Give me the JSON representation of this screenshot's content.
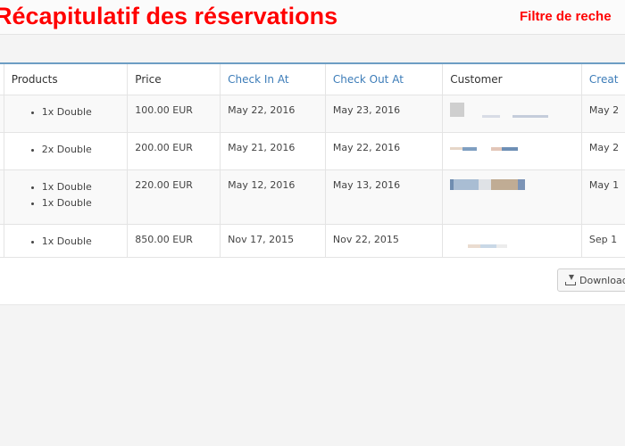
{
  "overlay": {
    "title": "Récapitulatif des réservations",
    "filter_label": "Filtre de reche"
  },
  "table": {
    "columns": [
      {
        "label": "Products",
        "sortable": false
      },
      {
        "label": "Price",
        "sortable": false
      },
      {
        "label": "Check In At",
        "sortable": true
      },
      {
        "label": "Check Out At",
        "sortable": true
      },
      {
        "label": "Customer",
        "sortable": false
      },
      {
        "label": "Creat",
        "sortable": true
      }
    ],
    "rows": [
      {
        "products": [
          "1x Double"
        ],
        "price": "100.00 EUR",
        "check_in": "May 22, 2016",
        "check_out": "May 23, 2016",
        "created": "May 2"
      },
      {
        "products": [
          "2x Double"
        ],
        "price": "200.00 EUR",
        "check_in": "May 21, 2016",
        "check_out": "May 22, 2016",
        "created": "May 2"
      },
      {
        "products": [
          "1x Double",
          "1x Double"
        ],
        "price": "220.00 EUR",
        "check_in": "May 12, 2016",
        "check_out": "May 13, 2016",
        "created": "May 1"
      },
      {
        "products": [
          "1x Double"
        ],
        "price": "850.00 EUR",
        "check_in": "Nov 17, 2015",
        "check_out": "Nov 22, 2015",
        "created": "Sep 1"
      }
    ]
  },
  "footer": {
    "download_label": "Download",
    "download_icon": "download-icon"
  },
  "colors": {
    "overlay_red": "#ff0000",
    "link_blue": "#3c7cb8",
    "panel_border_blue": "#6d9ec4"
  }
}
